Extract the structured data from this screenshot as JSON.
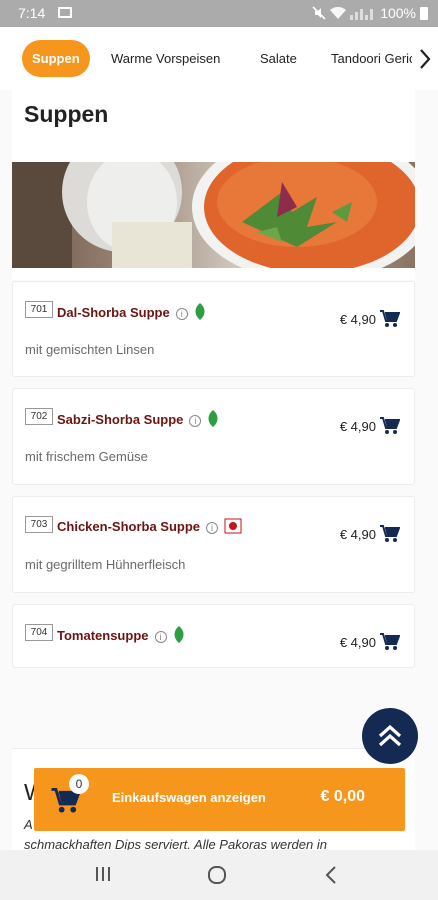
{
  "status_bar": {
    "time": "7:14",
    "battery": "100%"
  },
  "categories": {
    "items": [
      {
        "label": "Suppen",
        "active": true
      },
      {
        "label": "Warme Vorspeisen"
      },
      {
        "label": "Salate"
      },
      {
        "label": "Tandoori Gerichte"
      }
    ]
  },
  "section": {
    "title": "Suppen"
  },
  "dishes": [
    {
      "number": "701",
      "name": "Dal-Shorba Suppe",
      "description": "mit gemischten Linsen",
      "price": "€ 4,90",
      "badge": "vegetarian"
    },
    {
      "number": "702",
      "name": "Sabzi-Shorba Suppe",
      "description": "mit frischem Gemüse",
      "price": "€ 4,90",
      "badge": "vegetarian"
    },
    {
      "number": "703",
      "name": "Chicken-Shorba Suppe",
      "description": "mit gegrilltem Hühnerfleisch",
      "price": "€ 4,90",
      "badge": "non-vegetarian"
    },
    {
      "number": "704",
      "name": "Tomatensuppe",
      "description": "",
      "price": "€ 4,90",
      "badge": "vegetarian"
    }
  ],
  "next_section": {
    "title_start": "W",
    "text_start": "A",
    "text_line": "schmackhaften Dips serviert. Alle Pakoras werden in"
  },
  "cart": {
    "count": "0",
    "label": "Einkaufswagen anzeigen",
    "total": "€ 0,00"
  },
  "colors": {
    "accent": "#f7961d",
    "dish_name": "#6b1512",
    "navy": "#142a52",
    "veg_green": "#2e9e45",
    "nonveg_red": "#c0161d"
  }
}
